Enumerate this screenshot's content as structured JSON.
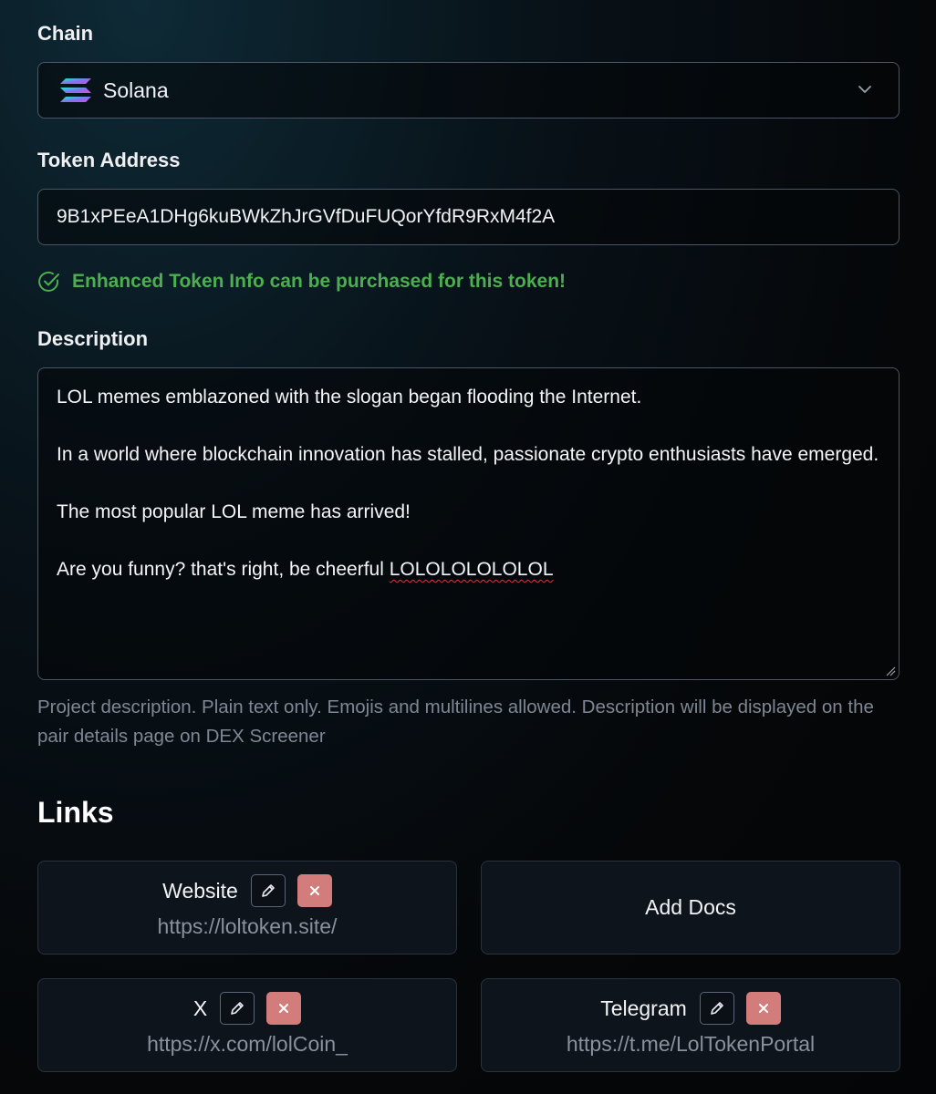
{
  "chain": {
    "label": "Chain",
    "selected": "Solana",
    "logo_icon": "solana-logo",
    "dropdown_icon": "chevron-down-icon"
  },
  "token": {
    "label": "Token Address",
    "value": "9B1xPEeA1DHg6kuBWkZhJrGVfDuFUQorYfdR9RxM4f2A"
  },
  "notice": {
    "icon": "check-circle-icon",
    "text": "Enhanced Token Info can be purchased for this token!",
    "color": "#4cae50"
  },
  "description": {
    "label": "Description",
    "paragraphs": [
      "LOL memes emblazoned with the slogan began flooding the Internet.",
      "In a world where blockchain innovation has stalled, passionate crypto enthusiasts have emerged.",
      "The most popular LOL meme has arrived!"
    ],
    "last_line_prefix": "Are you funny? that's right, be cheerful ",
    "last_line_misspelled": "LOLOLOLOLOLOL",
    "help": "Project description. Plain text only. Emojis and multilines allowed. Description will be displayed on the pair details page on DEX Screener"
  },
  "links": {
    "title": "Links",
    "items": [
      {
        "title": "Website",
        "url": "https://loltoken.site/"
      },
      {
        "title": "Add Docs"
      },
      {
        "title": "X",
        "url": "https://x.com/lolCoin_"
      },
      {
        "title": "Telegram",
        "url": "https://t.me/LolTokenPortal"
      }
    ],
    "edit_icon": "pencil-icon",
    "delete_icon": "close-icon",
    "delete_color": "#d27c7c"
  }
}
